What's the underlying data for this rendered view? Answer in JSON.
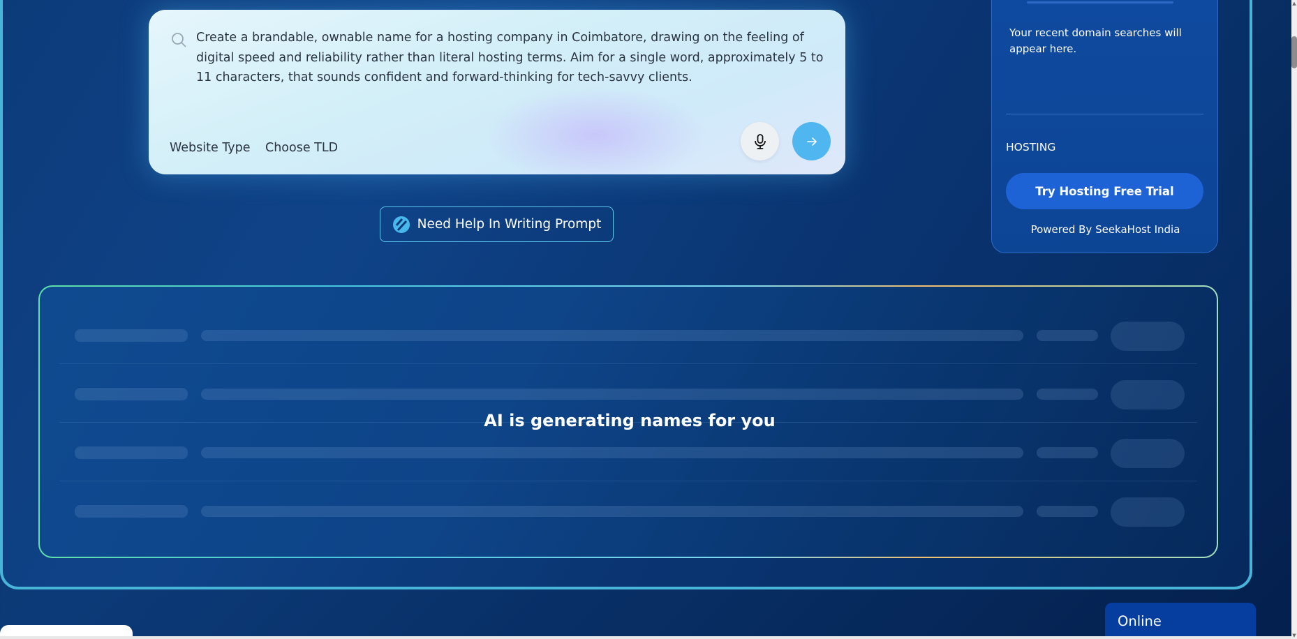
{
  "search": {
    "prompt": "Create a brandable, ownable name for a hosting company in Coimbatore, drawing on the feeling of digital speed and reliability rather than literal hosting terms. Aim for a single word, approximately 5 to 11 characters, that sounds confident and forward-thinking for tech-savvy clients.",
    "website_type_label": "Website Type",
    "choose_tld_label": "Choose TLD"
  },
  "help": {
    "label": "Need Help In Writing Prompt"
  },
  "sidebar": {
    "recent_text": "Your recent domain searches will appear here.",
    "hosting_label": "HOSTING",
    "trial_button": "Try Hosting Free Trial",
    "powered_by": "Powered By SeekaHost India"
  },
  "results": {
    "status": "AI is generating names for you"
  },
  "chat": {
    "status": "Online"
  },
  "colors": {
    "accent": "#4fb6f0",
    "primary_button": "#1e63d6",
    "frame_border": "#48b4d8",
    "chat_widget": "#063ea0"
  }
}
